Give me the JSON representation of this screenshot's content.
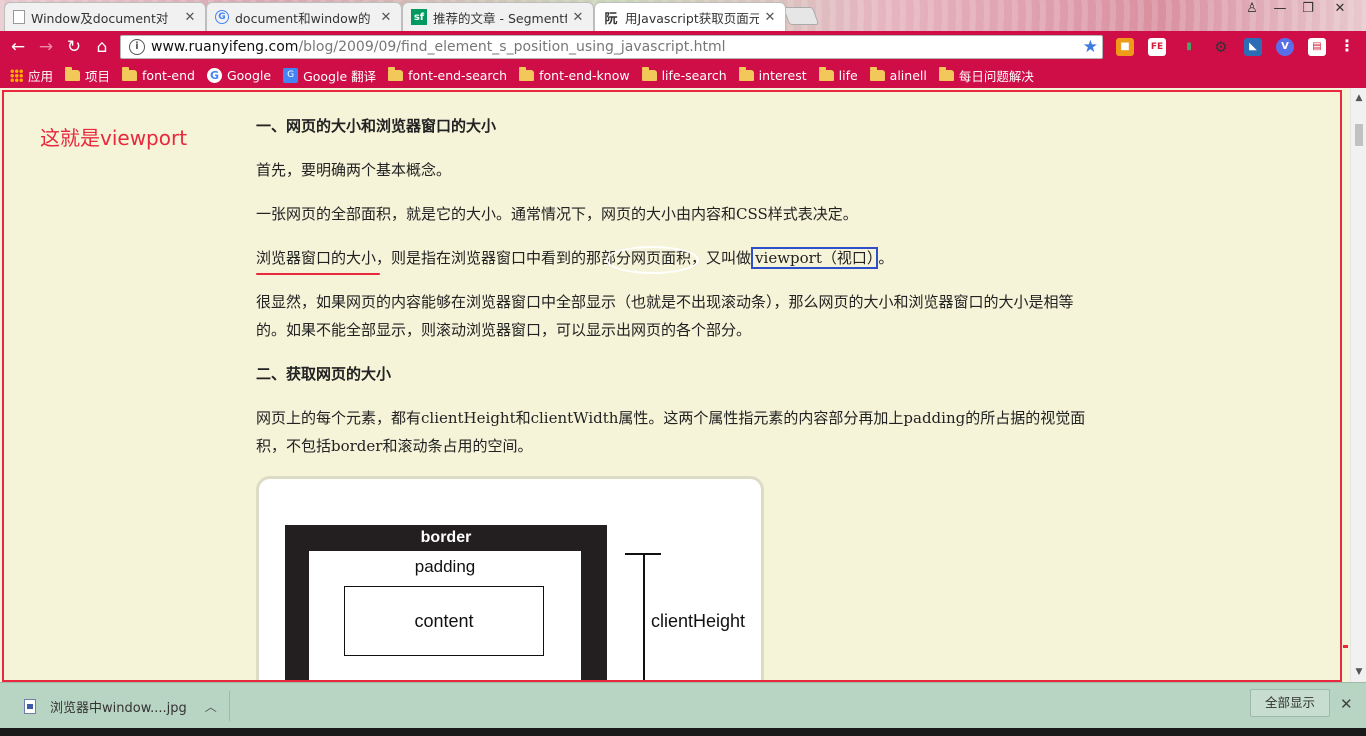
{
  "tabs": [
    {
      "title": "Window及document对",
      "icon": "document-icon"
    },
    {
      "title": "document和window的",
      "icon": "google-icon"
    },
    {
      "title": "推荐的文章 - Segmentf",
      "icon": "sf-icon"
    },
    {
      "title": "用Javascript获取页面元",
      "icon": "ruanyifeng-icon",
      "active": true
    }
  ],
  "toolbar": {
    "url_host": "www.ruanyifeng.com",
    "url_path": "/blog/2009/09/find_element_s_position_using_javascript.html"
  },
  "bookmarks": [
    {
      "label": "应用",
      "icon": "apps-icon"
    },
    {
      "label": "项目",
      "icon": "folder-icon"
    },
    {
      "label": "font-end",
      "icon": "folder-icon"
    },
    {
      "label": "Google",
      "icon": "google-icon"
    },
    {
      "label": "Google 翻译",
      "icon": "translate-icon"
    },
    {
      "label": "font-end-search",
      "icon": "folder-icon"
    },
    {
      "label": "font-end-know",
      "icon": "folder-icon"
    },
    {
      "label": "life-search",
      "icon": "folder-icon"
    },
    {
      "label": "interest",
      "icon": "folder-icon"
    },
    {
      "label": "life",
      "icon": "folder-icon"
    },
    {
      "label": "alinell",
      "icon": "folder-icon"
    },
    {
      "label": "每日问题解决",
      "icon": "folder-icon"
    }
  ],
  "annotation": {
    "viewport_label": "这就是viewport",
    "color": "#e8283c"
  },
  "article": {
    "h1": "一、网页的大小和浏览器窗口的大小",
    "p1": "首先，要明确两个基本概念。",
    "p2": "一张网页的全部面积，就是它的大小。通常情况下，网页的大小由内容和CSS样式表决定。",
    "p3_a": "浏览器窗口的大小",
    "p3_b": "，则是指在浏览器窗口中看到的那部",
    "p3_c": "分网页面积",
    "p3_d": "，又叫做",
    "p3_e": "viewport（视口）",
    "p3_f": "。",
    "p4": "很显然，如果网页的内容能够在浏览器窗口中全部显示（也就是不出现滚动条），那么网页的大小和浏览器窗口的大小是相等的。如果不能全部显示，则滚动浏览器窗口，可以显示出网页的各个部分。",
    "h2": "二、获取网页的大小",
    "p5": "网页上的每个元素，都有clientHeight和clientWidth属性。这两个属性指元素的内容部分再加上padding的所占据的视觉面积，不包括border和滚动条占用的空间。"
  },
  "figure": {
    "border_label": "border",
    "padding_label": "padding",
    "content_label": "content",
    "client_height_label": "clientHeight"
  },
  "download_shelf": {
    "file_name": "浏览器中window....jpg",
    "show_all": "全部显示"
  },
  "colors": {
    "chrome_theme": "#cf0d47",
    "page_background": "#f5f3d8",
    "highlight_box": "#2e4fc9"
  }
}
